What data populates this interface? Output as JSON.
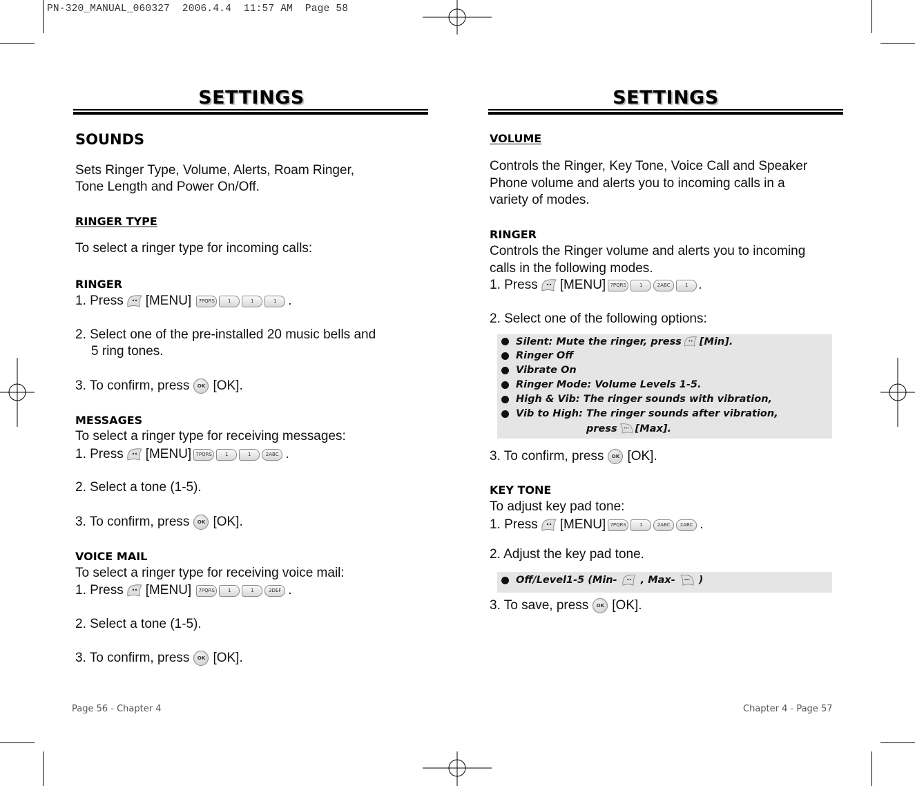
{
  "print_slug": "PN-320_MANUAL_060327  2006.4.4  11:57 AM  Page 58",
  "left_page": {
    "title": "SETTINGS",
    "section_title": "SOUNDS",
    "intro": [
      "Sets Ringer Type, Volume, Alerts, Roam Ringer,",
      "Tone Length and Power On/Off."
    ],
    "subsection_title": "RINGER TYPE",
    "subsection_intro": "To select a ringer type for incoming calls:",
    "ringer": {
      "heading": "RINGER",
      "step1_prefix": "1. Press",
      "step1_menu": "[MENU]",
      "step1_keys": [
        "7PQRS",
        "1",
        "1",
        "1"
      ],
      "step1_suffix": ".",
      "step2": [
        "2. Select one of the pre-installed 20 music bells and",
        "5 ring tones."
      ],
      "step3_prefix": "3. To confirm, press",
      "step3_key": "OK",
      "step3_suffix": "[OK]."
    },
    "messages": {
      "heading": "MESSAGES",
      "intro": "To select a ringer type for receiving messages:",
      "step1_prefix": "1. Press",
      "step1_menu": "[MENU]",
      "step1_keys": [
        "7PQRS",
        "1",
        "1",
        "2ABC"
      ],
      "step1_suffix": ".",
      "step2": "2. Select a tone (1-5).",
      "step3_prefix": "3. To confirm, press",
      "step3_key": "OK",
      "step3_suffix": "[OK]."
    },
    "voice_mail": {
      "heading": "VOICE MAIL",
      "intro": "To select a ringer type for receiving voice mail:",
      "step1_prefix": "1. Press",
      "step1_menu": "[MENU]",
      "step1_keys": [
        "7PQRS",
        "1",
        "1",
        "3DEF"
      ],
      "step1_suffix": ".",
      "step2": "2. Select a tone (1-5).",
      "step3_prefix": "3. To confirm, press",
      "step3_key": "OK",
      "step3_suffix": "[OK]."
    },
    "footer": "Page 56 - Chapter 4"
  },
  "right_page": {
    "title": "SETTINGS",
    "section_title": "VOLUME",
    "intro": [
      "Controls the Ringer, Key Tone, Voice Call and Speaker",
      "Phone volume and alerts you to incoming calls in a",
      "variety of modes."
    ],
    "ringer": {
      "heading": "RINGER",
      "intro": [
        "Controls the Ringer volume and alerts you to incoming",
        "calls in the following modes."
      ],
      "step1_prefix": "1. Press",
      "step1_menu": "[MENU]",
      "step1_keys": [
        "7PQRS",
        "1",
        "2ABC",
        "1"
      ],
      "step1_suffix": ".",
      "step2": "2. Select one of the following options:",
      "options": [
        "Silent: Mute the ringer, press",
        "Ringer Off",
        "Vibrate On",
        "Ringer Mode: Volume Levels 1-5.",
        "High & Vib: The ringer sounds with vibration,",
        "Vib to High: The ringer sounds after vibration,"
      ],
      "option1_suffix": "[Min].",
      "option6_cont_prefix": "press",
      "option6_cont_suffix": "[Max].",
      "step3_prefix": "3. To confirm, press",
      "step3_key": "OK",
      "step3_suffix": "[OK]."
    },
    "key_tone": {
      "heading": "KEY TONE",
      "intro": "To adjust key pad tone:",
      "step1_prefix": "1. Press",
      "step1_menu": "[MENU]",
      "step1_keys": [
        "7PQRS",
        "1",
        "2ABC",
        "2ABC"
      ],
      "step1_suffix": ".",
      "step2": "2. Adjust the key pad tone.",
      "option_prefix": "Off/Level1-5 (Min-",
      "option_mid": ", Max-",
      "option_suffix": ")",
      "step3_prefix": "3. To save, press",
      "step3_key": "OK",
      "step3_suffix": "[OK]."
    },
    "footer": "Chapter 4 - Page 57"
  }
}
